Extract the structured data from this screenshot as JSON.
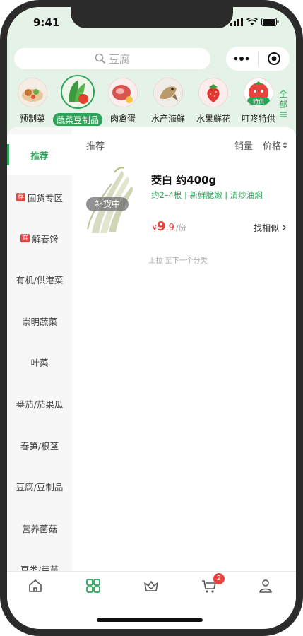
{
  "status_bar": {
    "time": "9:41"
  },
  "search": {
    "placeholder": "豆腐"
  },
  "categories": [
    {
      "label": "预制菜",
      "icon": "prepared-dish-icon",
      "selected": false
    },
    {
      "label": "蔬菜豆制品",
      "icon": "vegetables-icon",
      "selected": true
    },
    {
      "label": "肉禽蛋",
      "icon": "meat-icon",
      "selected": false
    },
    {
      "label": "水产海鲜",
      "icon": "seafood-icon",
      "selected": false
    },
    {
      "label": "水果鲜花",
      "icon": "fruit-icon",
      "selected": false
    },
    {
      "label": "叮咚特供",
      "icon": "special-offer-icon",
      "badge": "特供",
      "selected": false
    }
  ],
  "all_categories": {
    "label": "全部"
  },
  "sidebar": {
    "items": [
      {
        "label": "推荐",
        "selected": true
      },
      {
        "label": "国货专区",
        "tag": "荐"
      },
      {
        "label": "解春馋",
        "tag": "鲜"
      },
      {
        "label": "有机/供港菜"
      },
      {
        "label": "崇明蔬菜"
      },
      {
        "label": "叶菜"
      },
      {
        "label": "番茄/茄果瓜"
      },
      {
        "label": "春笋/根茎"
      },
      {
        "label": "豆腐/豆制品"
      },
      {
        "label": "营养菌菇"
      },
      {
        "label": "豆类/芽苗"
      }
    ]
  },
  "sort_bar": {
    "recommend": "推荐",
    "sales": "销量",
    "price": "价格"
  },
  "product": {
    "name": "茭白 约400g",
    "description": "约2–4根 | 新鲜脆嫩 | 清炒油焖",
    "status": "补货中",
    "currency": "¥",
    "price_int": "9",
    "price_dec": ".9",
    "unit": "/份",
    "similar": "找相似"
  },
  "pull_hint": "上拉 至下一个分类",
  "tabbar": {
    "cart_badge": "2"
  },
  "colors": {
    "accent": "#2fa35a",
    "price": "#e8433d",
    "header_bg": "#e5f2e7"
  }
}
